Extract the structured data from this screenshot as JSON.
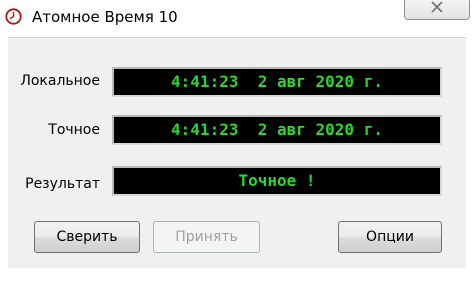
{
  "window": {
    "title": "Атомное Время 10",
    "icon": "clock-icon",
    "close_icon": "close-icon"
  },
  "rows": [
    {
      "label": "Локальное",
      "value": "4:41:23  2 авг 2020 г."
    },
    {
      "label": "Точное",
      "value": "4:41:23  2 авг 2020 г."
    },
    {
      "label": "Результат",
      "value": "Точное !"
    }
  ],
  "buttons": {
    "sync": "Сверить",
    "accept": "Принять",
    "options": "Опции"
  },
  "colors": {
    "display_background": "#000000",
    "display_text": "#2dd62d"
  }
}
